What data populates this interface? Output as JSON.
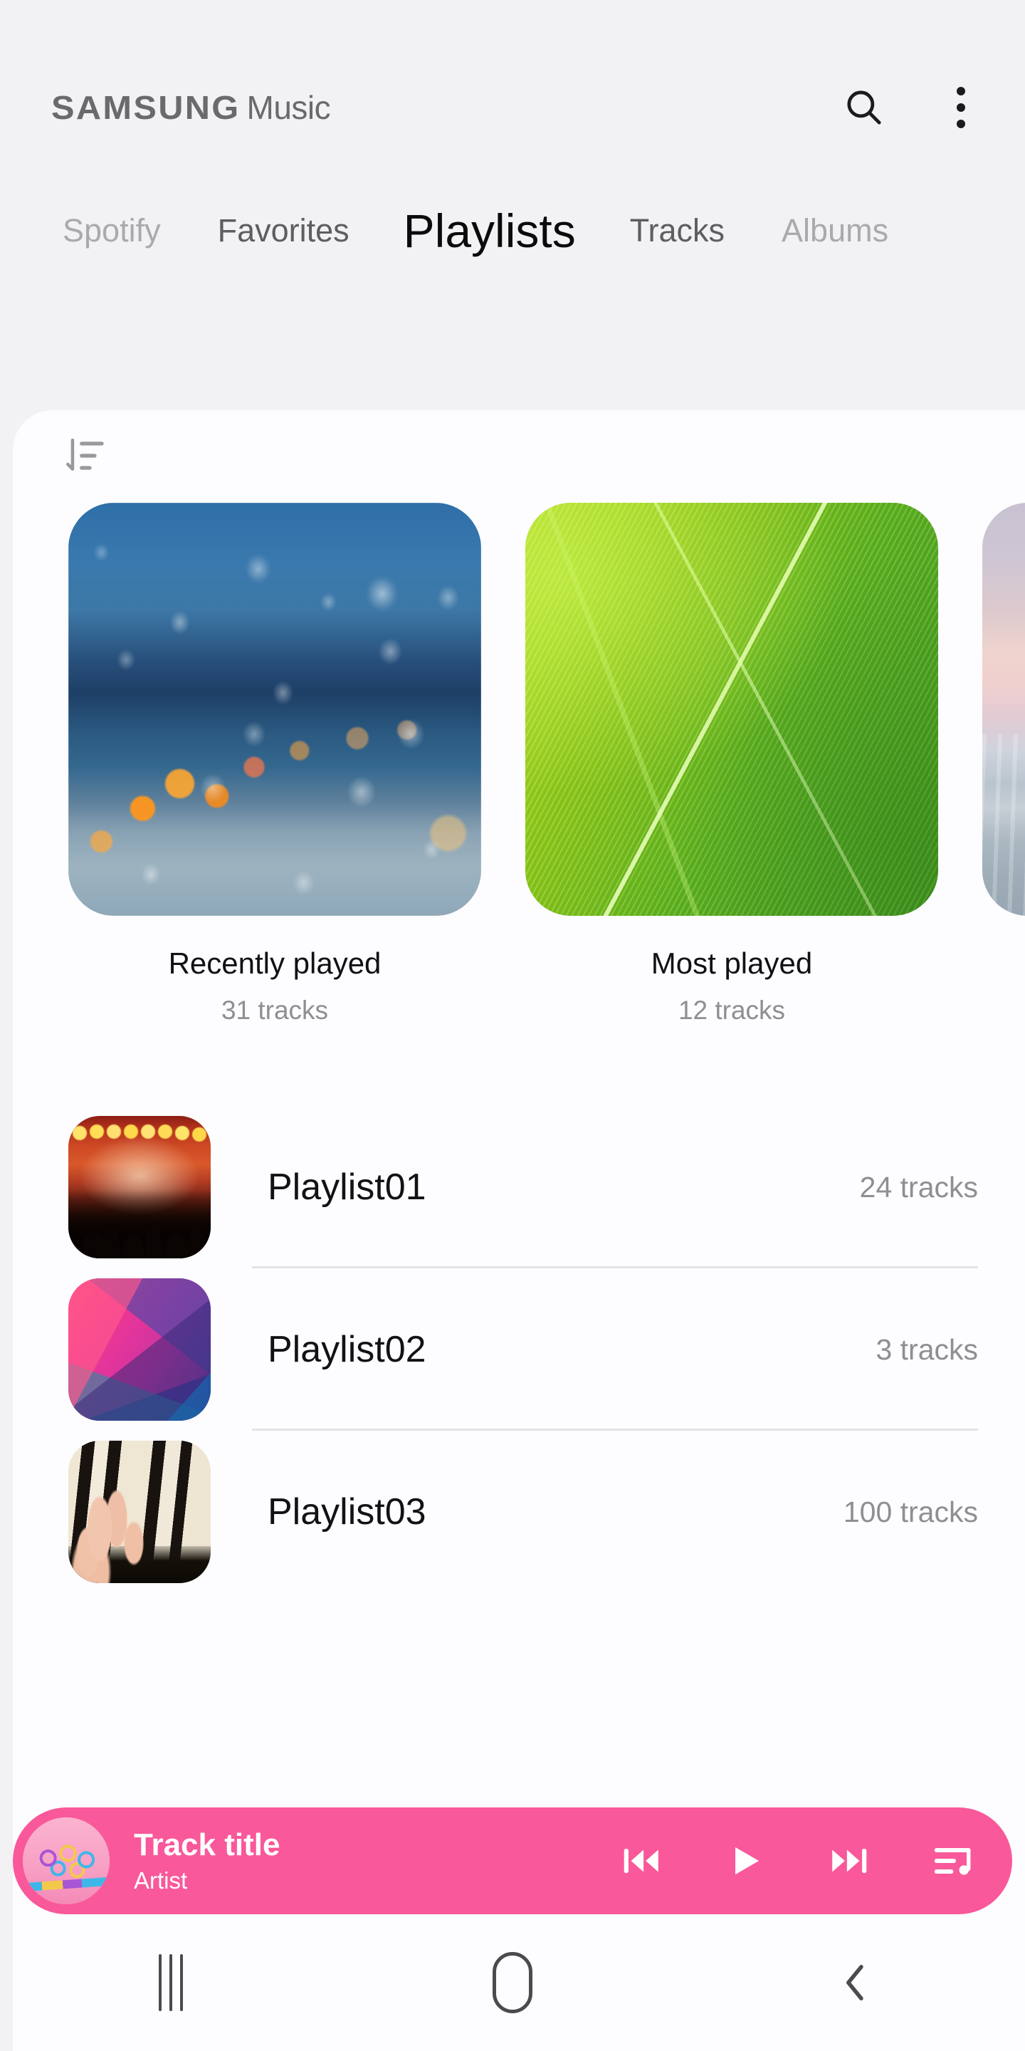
{
  "app": {
    "brand_primary": "SAMSUNG",
    "brand_secondary": "Music",
    "accent_color": "#f9589a",
    "background_color": "#f2f1f4",
    "sheet_color": "#fdfcfe"
  },
  "header": {
    "search_icon": "search-icon",
    "overflow_icon": "more-vertical-icon"
  },
  "tabs": [
    {
      "label": "Spotify",
      "active": false,
      "edge": true
    },
    {
      "label": "Favorites",
      "active": false,
      "edge": false
    },
    {
      "label": "Playlists",
      "active": true,
      "edge": false
    },
    {
      "label": "Tracks",
      "active": false,
      "edge": false
    },
    {
      "label": "Albums",
      "active": false,
      "edge": true
    }
  ],
  "toolbar": {
    "sort_icon": "sort-descending-icon"
  },
  "featured": [
    {
      "title": "Recently played",
      "subtitle": "31 tracks",
      "art": "rainy-window-city-lights"
    },
    {
      "title": "Most played",
      "subtitle": "12 tracks",
      "art": "green-leaves-closeup"
    },
    {
      "title": "",
      "subtitle": "",
      "art": "pastel-sunset-seascape"
    }
  ],
  "playlists": [
    {
      "name": "Playlist01",
      "count": "24 tracks",
      "art": "concert-crowd-stage-lights"
    },
    {
      "name": "Playlist02",
      "count": "3 tracks",
      "art": "pink-geometric-gradient"
    },
    {
      "name": "Playlist03",
      "count": "100 tracks",
      "art": "piano-keys-hand"
    }
  ],
  "miniplayer": {
    "title": "Track title",
    "artist": "Artist",
    "art": "pink-ribbon-album-art",
    "controls": {
      "previous": "skip-previous-icon",
      "play": "play-icon",
      "next": "skip-next-icon",
      "queue": "queue-music-icon"
    }
  },
  "navbar": {
    "recents": "recents-icon",
    "home": "home-icon",
    "back": "back-icon"
  }
}
